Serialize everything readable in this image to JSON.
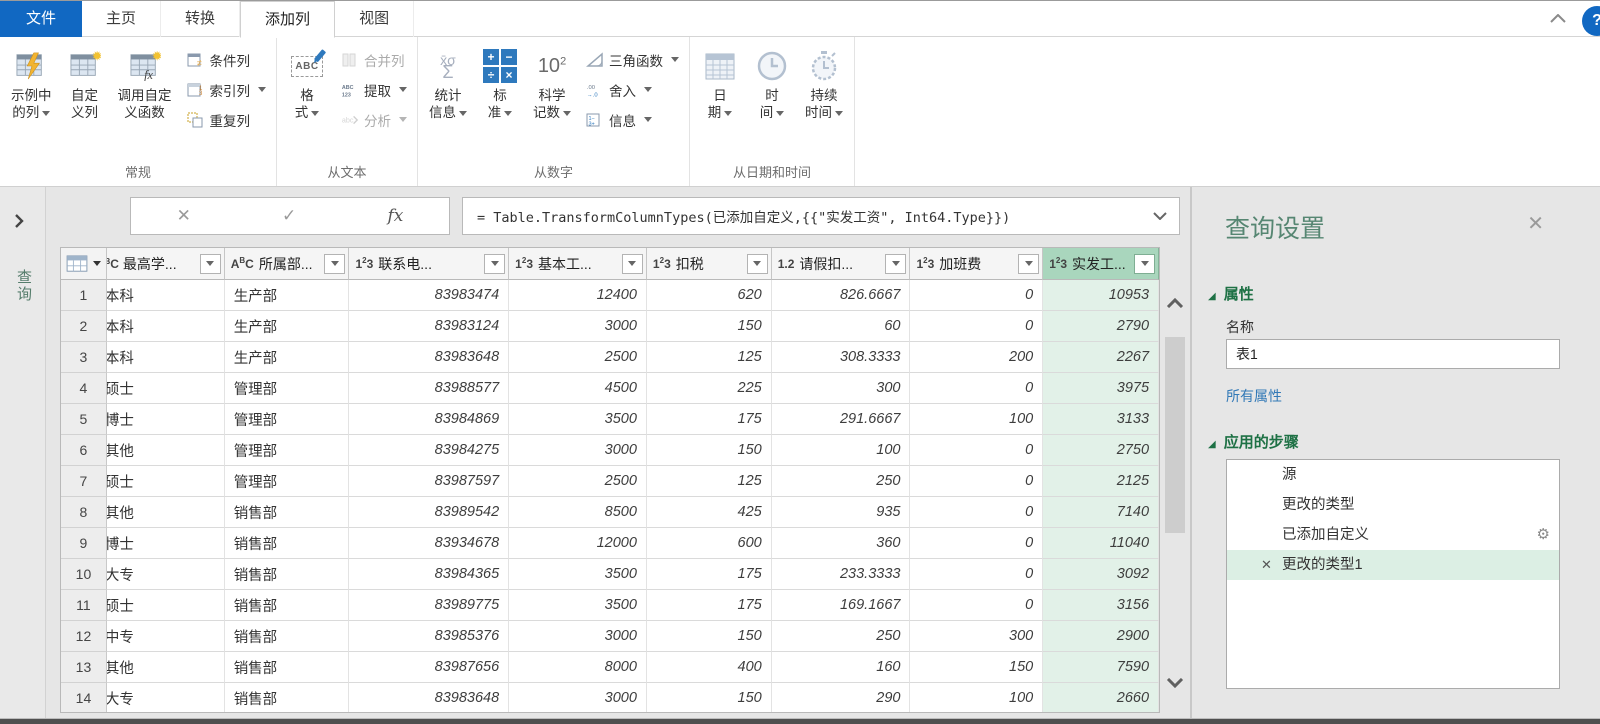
{
  "tabs": {
    "items": [
      {
        "label": "文件",
        "style": "file"
      },
      {
        "label": "主页"
      },
      {
        "label": "转换"
      },
      {
        "label": "添加列",
        "active": true
      },
      {
        "label": "视图"
      }
    ]
  },
  "ribbon": {
    "groups": [
      {
        "label": "常规",
        "big": [
          {
            "name": "column-from-examples",
            "line1": "示例中",
            "line2": "的列",
            "dropdown": true,
            "icon": "table-lightning"
          },
          {
            "name": "custom-column",
            "line1": "自定",
            "line2": "义列",
            "dropdown": false,
            "icon": "table-star"
          },
          {
            "name": "invoke-custom-function",
            "line1": "调用自定",
            "line2": "义函数",
            "dropdown": false,
            "icon": "table-fx"
          }
        ],
        "small": [
          {
            "name": "conditional-column",
            "label": "条件列",
            "dropdown": false,
            "disabled": false,
            "icon": "cond"
          },
          {
            "name": "index-column",
            "label": "索引列",
            "dropdown": true,
            "disabled": false,
            "icon": "index"
          },
          {
            "name": "duplicate-column",
            "label": "重复列",
            "dropdown": false,
            "disabled": false,
            "icon": "dup"
          }
        ]
      },
      {
        "label": "从文本",
        "big": [
          {
            "name": "format",
            "line1": "格",
            "line2": "式",
            "dropdown": true,
            "icon": "abc-pencil"
          }
        ],
        "small": [
          {
            "name": "merge-columns",
            "label": "合并列",
            "dropdown": false,
            "disabled": true,
            "icon": "merge"
          },
          {
            "name": "extract",
            "label": "提取",
            "dropdown": true,
            "disabled": false,
            "icon": "extract"
          },
          {
            "name": "parse",
            "label": "分析",
            "dropdown": true,
            "disabled": true,
            "icon": "parse"
          }
        ]
      },
      {
        "label": "从数字",
        "big": [
          {
            "name": "statistics",
            "line1": "统计",
            "line2": "信息",
            "dropdown": true,
            "icon": "sigma"
          },
          {
            "name": "standard",
            "line1": "标",
            "line2": "准",
            "dropdown": true,
            "icon": "math-ops"
          },
          {
            "name": "scientific",
            "line1": "科学",
            "line2": "记数",
            "dropdown": true,
            "icon": "ten-squared"
          }
        ],
        "small": [
          {
            "name": "trigonometry",
            "label": "三角函数",
            "dropdown": true,
            "disabled": false,
            "icon": "trig"
          },
          {
            "name": "rounding",
            "label": "舍入",
            "dropdown": true,
            "disabled": false,
            "icon": "round"
          },
          {
            "name": "information",
            "label": "信息",
            "dropdown": true,
            "disabled": false,
            "icon": "info"
          }
        ]
      },
      {
        "label": "从日期和时间",
        "big": [
          {
            "name": "date",
            "line1": "日",
            "line2": "期",
            "dropdown": true,
            "icon": "calendar"
          },
          {
            "name": "time",
            "line1": "时",
            "line2": "间",
            "dropdown": true,
            "icon": "clock"
          },
          {
            "name": "duration",
            "line1": "持续",
            "line2": "时间",
            "dropdown": true,
            "icon": "stopwatch"
          }
        ],
        "small": []
      }
    ]
  },
  "sidebar": {
    "queries_label": "查询"
  },
  "formula_bar": {
    "formula": "= Table.TransformColumnTypes(已添加自定义,{{\"实发工资\", Int64.Type}})",
    "cancel_glyph": "✕",
    "commit_glyph": "✓",
    "fx_glyph": "fx"
  },
  "table": {
    "columns": [
      {
        "type": "ABC",
        "label": "最高学...",
        "clipped": true
      },
      {
        "type": "ABC",
        "label": "所属部..."
      },
      {
        "type": "123",
        "label": "联系电..."
      },
      {
        "type": "123",
        "label": "基本工..."
      },
      {
        "type": "123",
        "label": "扣税"
      },
      {
        "type": "1.2",
        "label": "请假扣..."
      },
      {
        "type": "123",
        "label": "加班费"
      },
      {
        "type": "123",
        "label": "实发工...",
        "selected": true
      }
    ],
    "rows": [
      [
        "1",
        "本科",
        "生产部",
        "83983474",
        "12400",
        "620",
        "826.6667",
        "0",
        "10953"
      ],
      [
        "2",
        "本科",
        "生产部",
        "83983124",
        "3000",
        "150",
        "60",
        "0",
        "2790"
      ],
      [
        "3",
        "本科",
        "生产部",
        "83983648",
        "2500",
        "125",
        "308.3333",
        "200",
        "2267"
      ],
      [
        "4",
        "硕士",
        "管理部",
        "83988577",
        "4500",
        "225",
        "300",
        "0",
        "3975"
      ],
      [
        "5",
        "博士",
        "管理部",
        "83984869",
        "3500",
        "175",
        "291.6667",
        "100",
        "3133"
      ],
      [
        "6",
        "其他",
        "管理部",
        "83984275",
        "3000",
        "150",
        "100",
        "0",
        "2750"
      ],
      [
        "7",
        "硕士",
        "管理部",
        "83987597",
        "2500",
        "125",
        "250",
        "0",
        "2125"
      ],
      [
        "8",
        "其他",
        "销售部",
        "83989542",
        "8500",
        "425",
        "935",
        "0",
        "7140"
      ],
      [
        "9",
        "博士",
        "销售部",
        "83934678",
        "12000",
        "600",
        "360",
        "0",
        "11040"
      ],
      [
        "10",
        "大专",
        "销售部",
        "83984365",
        "3500",
        "175",
        "233.3333",
        "0",
        "3092"
      ],
      [
        "11",
        "硕士",
        "销售部",
        "83989775",
        "3500",
        "175",
        "169.1667",
        "0",
        "3156"
      ],
      [
        "12",
        "中专",
        "销售部",
        "83985376",
        "3000",
        "150",
        "250",
        "300",
        "2900"
      ],
      [
        "13",
        "其他",
        "销售部",
        "83987656",
        "8000",
        "400",
        "160",
        "150",
        "7590"
      ],
      [
        "14",
        "大专",
        "销售部",
        "83983648",
        "3000",
        "150",
        "290",
        "100",
        "2660"
      ]
    ]
  },
  "query_settings": {
    "title": "查询设置",
    "close_glyph": "✕",
    "properties_label": "属性",
    "name_label": "名称",
    "name_value": "表1",
    "all_properties_link": "所有属性",
    "applied_steps_label": "应用的步骤",
    "steps": [
      {
        "label": "源"
      },
      {
        "label": "更改的类型"
      },
      {
        "label": "已添加自定义",
        "gear": true
      },
      {
        "label": "更改的类型1",
        "selected": true,
        "deletable": true
      }
    ]
  },
  "colors": {
    "accent_blue": "#1168c2",
    "excel_green": "#1e7145",
    "panel_title_green": "#568672",
    "selected_column_header": "#a9d6bd",
    "selected_column_cell": "#e2f1e8",
    "selected_step_bg": "#dcefe4",
    "link_blue": "#3279b7"
  }
}
